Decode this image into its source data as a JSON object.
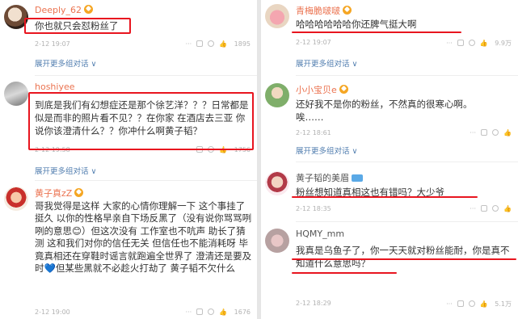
{
  "left": {
    "comments": [
      {
        "user": "Deeply_62",
        "text": "你也就只会怼粉丝了",
        "date": "2-12 19:07",
        "likes": "1895"
      },
      {
        "user": "hoshiyee",
        "text": "到底是我们有幻想症还是那个徐艺洋？？？日常都是似是而非的照片看不见？？在你家 在酒店去三亚 你说你该澄清什么？？你冲什么啊黄子韬？",
        "date": "2-12 19:58",
        "likes": "1756"
      },
      {
        "user": "黄子真zZ",
        "text": "哥我觉得是这样 大家的心情你理解一下 这个事挂了挺久 以你的性格早亲自下场反黑了（没有说你骂骂咧咧的意思😊）但这次没有 工作室也不吭声 助长了猜测 这和我们对你的信任无关 但信任也不能消耗呀 毕竟真相还在穿鞋时谣言就跑遍全世界了 澄清还是要及时💙但某些黑就不必趁火打劫了 黄子韬不欠什么",
        "date": "2-12 19:00",
        "likes": "1676"
      }
    ],
    "expand_label": "展开更多组对话 ∨"
  },
  "right": {
    "comments": [
      {
        "user": "青梅脆啵啵",
        "text": "哈哈哈哈哈哈你还脾气挺大啊",
        "date": "2-12 19:07",
        "likes": "9.9万"
      },
      {
        "user": "小小宝贝e",
        "text": "还好我不是你的粉丝，不然真的很寒心啊。\n唉……",
        "date": "2-12 18:61",
        "likes": ""
      },
      {
        "user": "黄子韬的美眉",
        "text": "粉丝想知道真相这也有错吗？大少爷",
        "date": "2-12 18:35",
        "likes": ""
      },
      {
        "user": "HQMY_mm",
        "text": "我真是乌鱼子了，你一天天就对粉丝能耐，你是真不知道什么意思吗？",
        "date": "2-12 18:29",
        "likes": "5.1万"
      }
    ],
    "expand_label": "展开更多组对话 ∨"
  },
  "colors": {
    "accent_name": "#eb7350",
    "link": "#507daf",
    "annotation": "#e8151f",
    "meta": "#b2b2b2"
  },
  "icons": [
    "more-icon",
    "share-icon",
    "comment-icon",
    "like-icon",
    "vip-badge-icon"
  ]
}
